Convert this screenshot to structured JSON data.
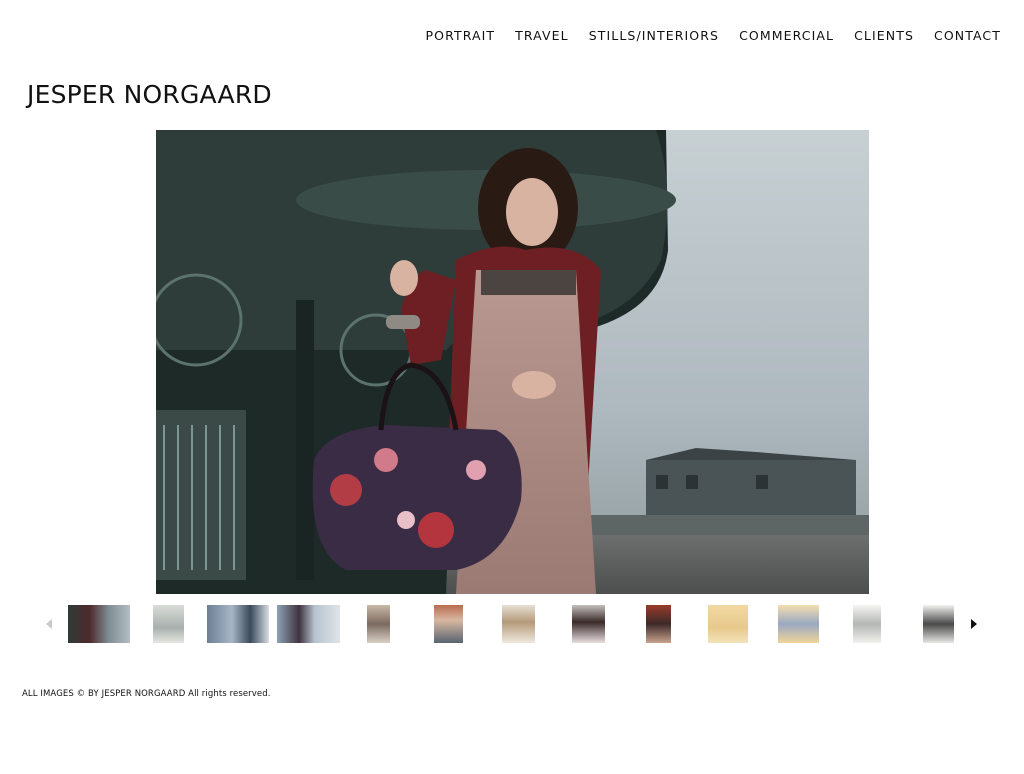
{
  "nav": {
    "items": [
      {
        "label": "PORTRAIT"
      },
      {
        "label": "TRAVEL"
      },
      {
        "label": "STILLS/INTERIORS"
      },
      {
        "label": "COMMERCIAL"
      },
      {
        "label": "CLIENTS"
      },
      {
        "label": "CONTACT"
      }
    ]
  },
  "site": {
    "title": "JESPER NORGAARD"
  },
  "gallery": {
    "prev_icon": "chevron-left-icon",
    "next_icon": "chevron-right-icon",
    "thumbnail_count": 13
  },
  "footer": {
    "copyright": "ALL IMAGES © BY JESPER NORGAARD All rights reserved."
  },
  "colors": {
    "background": "#ffffff",
    "text": "#111111",
    "disabled_arrow": "#c8c8c8"
  }
}
